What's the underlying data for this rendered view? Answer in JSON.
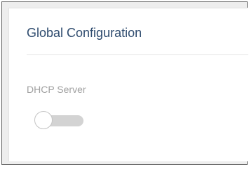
{
  "panel": {
    "title": "Global Configuration",
    "fields": [
      {
        "label": "DHCP Server",
        "control": "toggle",
        "enabled": false
      }
    ]
  },
  "colors": {
    "title": "#2e4b6e",
    "label": "#a0a0a0",
    "toggle_track_off": "#d3d3d3",
    "toggle_knob": "#ffffff"
  }
}
